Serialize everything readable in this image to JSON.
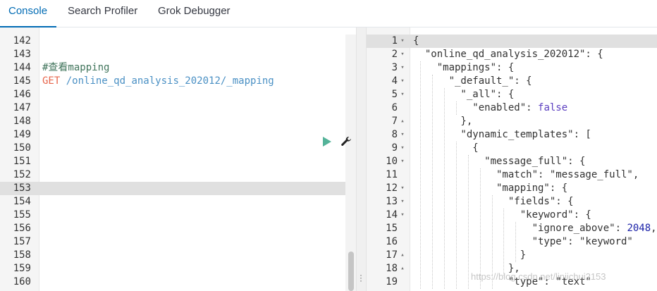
{
  "tabs": [
    "Console",
    "Search Profiler",
    "Grok Debugger"
  ],
  "left_editor": {
    "lines": [
      {
        "n": "142",
        "parts": []
      },
      {
        "n": "143",
        "parts": []
      },
      {
        "n": "144",
        "parts": [
          {
            "t": "#查看mapping",
            "c": "c-comment"
          }
        ]
      },
      {
        "n": "145",
        "parts": [
          {
            "t": "GET",
            "c": "c-method"
          },
          {
            "t": " /online_qd_analysis_202012/_mapping",
            "c": "c-url"
          }
        ]
      },
      {
        "n": "146",
        "parts": []
      },
      {
        "n": "147",
        "parts": []
      },
      {
        "n": "148",
        "parts": []
      },
      {
        "n": "149",
        "parts": []
      },
      {
        "n": "150",
        "parts": []
      },
      {
        "n": "151",
        "parts": []
      },
      {
        "n": "152",
        "parts": []
      },
      {
        "n": "153",
        "parts": []
      },
      {
        "n": "154",
        "parts": []
      },
      {
        "n": "155",
        "parts": []
      },
      {
        "n": "156",
        "parts": []
      },
      {
        "n": "157",
        "parts": []
      },
      {
        "n": "158",
        "parts": []
      },
      {
        "n": "159",
        "parts": []
      },
      {
        "n": "160",
        "parts": []
      }
    ],
    "highlight_line": "153",
    "actions": {
      "run": "play-icon",
      "settings": "wrench-icon"
    }
  },
  "right_editor": {
    "lines": [
      {
        "n": "1",
        "f": "▾",
        "parts": [
          {
            "t": "{",
            "c": "c-str"
          }
        ]
      },
      {
        "n": "2",
        "f": "▾",
        "parts": [
          {
            "t": "  \"online_qd_analysis_202012\": {",
            "c": "c-key"
          }
        ]
      },
      {
        "n": "3",
        "f": "▾",
        "parts": [
          {
            "t": "    \"mappings\": {",
            "c": "c-key"
          }
        ]
      },
      {
        "n": "4",
        "f": "▾",
        "parts": [
          {
            "t": "      \"_default_\": {",
            "c": "c-key"
          }
        ]
      },
      {
        "n": "5",
        "f": "▾",
        "parts": [
          {
            "t": "        \"_all\": {",
            "c": "c-key"
          }
        ]
      },
      {
        "n": "6",
        "f": "",
        "parts": [
          {
            "t": "          \"enabled\": ",
            "c": "c-key"
          },
          {
            "t": "false",
            "c": "c-bool"
          }
        ]
      },
      {
        "n": "7",
        "f": "▴",
        "parts": [
          {
            "t": "        },",
            "c": "c-str"
          }
        ]
      },
      {
        "n": "8",
        "f": "▾",
        "parts": [
          {
            "t": "        \"dynamic_templates\": [",
            "c": "c-key"
          }
        ]
      },
      {
        "n": "9",
        "f": "▾",
        "parts": [
          {
            "t": "          {",
            "c": "c-str"
          }
        ]
      },
      {
        "n": "10",
        "f": "▾",
        "parts": [
          {
            "t": "            \"message_full\": {",
            "c": "c-key"
          }
        ]
      },
      {
        "n": "11",
        "f": "",
        "parts": [
          {
            "t": "              \"match\": \"message_full\",",
            "c": "c-key"
          }
        ]
      },
      {
        "n": "12",
        "f": "▾",
        "parts": [
          {
            "t": "              \"mapping\": {",
            "c": "c-key"
          }
        ]
      },
      {
        "n": "13",
        "f": "▾",
        "parts": [
          {
            "t": "                \"fields\": {",
            "c": "c-key"
          }
        ]
      },
      {
        "n": "14",
        "f": "▾",
        "parts": [
          {
            "t": "                  \"keyword\": {",
            "c": "c-key"
          }
        ]
      },
      {
        "n": "15",
        "f": "",
        "parts": [
          {
            "t": "                    \"ignore_above\": ",
            "c": "c-key"
          },
          {
            "t": "2048",
            "c": "c-num"
          },
          {
            "t": ",",
            "c": "c-str"
          }
        ]
      },
      {
        "n": "16",
        "f": "",
        "parts": [
          {
            "t": "                    \"type\": \"keyword\"",
            "c": "c-key"
          }
        ]
      },
      {
        "n": "17",
        "f": "▴",
        "parts": [
          {
            "t": "                  }",
            "c": "c-str"
          }
        ]
      },
      {
        "n": "18",
        "f": "▴",
        "parts": [
          {
            "t": "                },",
            "c": "c-str"
          }
        ]
      },
      {
        "n": "19",
        "f": "",
        "parts": [
          {
            "t": "                \"type\": \"text\"",
            "c": "c-key"
          }
        ]
      }
    ],
    "highlight_line": "1"
  },
  "watermark": "https://blog.csdn.net/linjichui2153"
}
